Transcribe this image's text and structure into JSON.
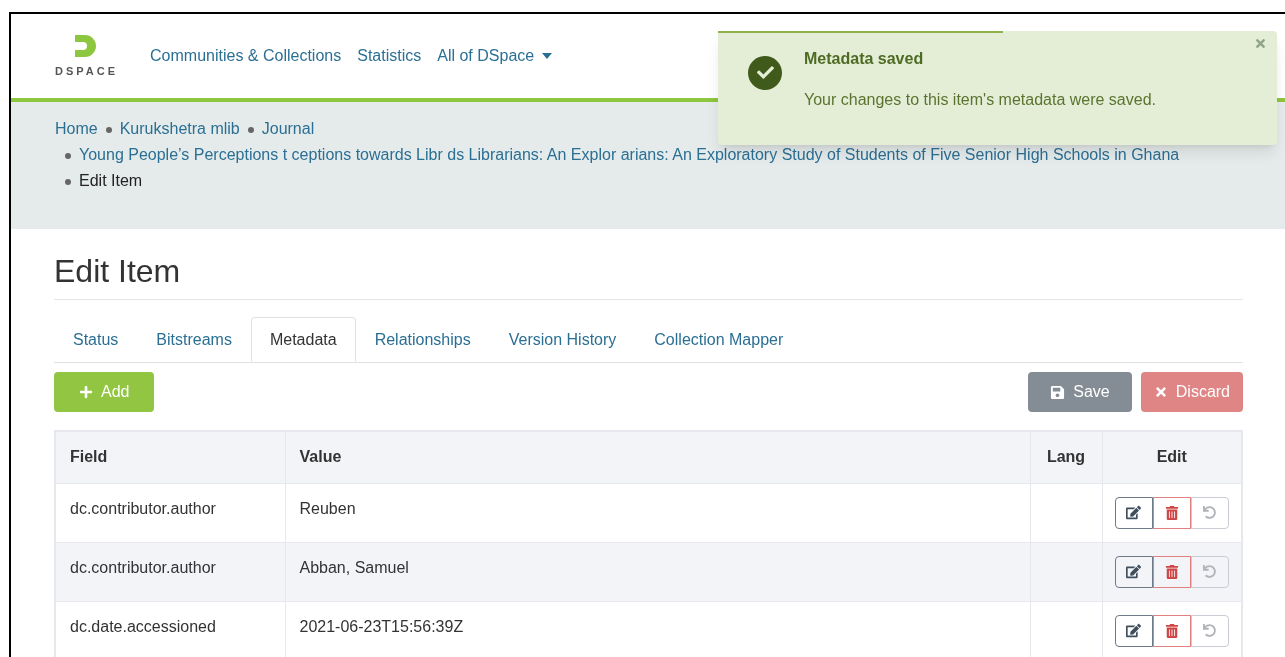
{
  "header": {
    "logo_text": "DSPACE",
    "nav": [
      {
        "label": "Communities & Collections",
        "dropdown": false
      },
      {
        "label": "Statistics",
        "dropdown": false
      },
      {
        "label": "All of DSpace",
        "dropdown": true
      }
    ]
  },
  "toast": {
    "title": "Metadata saved",
    "message": "Your changes to this item's metadata were saved.",
    "level": 0.51
  },
  "breadcrumb": [
    {
      "label": "Home",
      "link": true
    },
    {
      "label": "Kurukshetra mlib",
      "link": true
    },
    {
      "label": "Journal",
      "link": true
    },
    {
      "label": "Young People’s Perceptions t ceptions towards Libr ds Librarians: An Explor arians: An Exploratory Study of Students of Five Senior High Schools in Ghana",
      "link": true
    },
    {
      "label": "Edit Item",
      "link": false
    }
  ],
  "page_title": "Edit Item",
  "tabs": [
    {
      "label": "Status",
      "selected": false
    },
    {
      "label": "Bitstreams",
      "selected": false
    },
    {
      "label": "Metadata",
      "selected": true
    },
    {
      "label": "Relationships",
      "selected": false
    },
    {
      "label": "Version History",
      "selected": false
    },
    {
      "label": "Collection Mapper",
      "selected": false
    }
  ],
  "actions": {
    "add": {
      "label": "Add"
    },
    "save": {
      "label": "Save",
      "disabled": true
    },
    "discard": {
      "label": "Discard",
      "disabled": true
    }
  },
  "table": {
    "columns": [
      "Field",
      "Value",
      "Lang",
      "Edit"
    ],
    "rows": [
      {
        "field": "dc.contributor.author",
        "value": "Reuben",
        "undo_disabled": true
      },
      {
        "field": "dc.contributor.author",
        "value": "Abban, Samuel",
        "undo_disabled": true
      },
      {
        "field": "dc.date.accessioned",
        "value": "2021-06-23T15:56:39Z",
        "undo_disabled": true
      }
    ]
  }
}
